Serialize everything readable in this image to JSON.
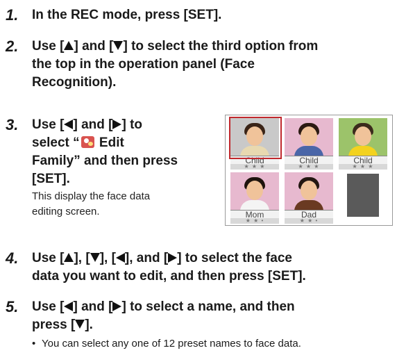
{
  "steps": [
    {
      "num": "1.",
      "text": "In the REC mode, press [SET]."
    },
    {
      "num": "2.",
      "lines": [
        "Use [▲] and [▼] to select the third option from",
        "the top in the operation panel (Face",
        "Recognition)."
      ]
    },
    {
      "num": "3.",
      "l1a": "Use [",
      "l1b": "] and [",
      "l1c": "] to",
      "l2a": "select “",
      "l2b": " Edit",
      "l3": "Family” and then press",
      "l4": "[SET].",
      "note1": "This display the face data",
      "note2": "editing screen."
    },
    {
      "num": "4.",
      "l1": [
        "Use [",
        "], [",
        "], [",
        "], and [",
        "] to select the face"
      ],
      "l2": "data you want to edit, and then press [SET]."
    },
    {
      "num": "5.",
      "l1a": "Use [",
      "l1b": "] and [",
      "l1c": "] to select a name, and then",
      "l2a": "press [",
      "l2b": "]."
    }
  ],
  "bullet": {
    "symbol": "•",
    "text": "You can select any one of 12 preset names to face data."
  },
  "screen": {
    "faces": [
      {
        "name": "Child",
        "stars": "★ ★ ★",
        "hair": "#3a2417",
        "shirt": "#e8d9b0",
        "bg": "#c9c9c9",
        "selected": true
      },
      {
        "name": "Child",
        "stars": "★ ★ ★",
        "hair": "#2b1a12",
        "shirt": "#4a66a8",
        "bg": "#e7b9cf",
        "selected": false
      },
      {
        "name": "Child",
        "stars": "★ ★ ★",
        "hair": "#3b2a1c",
        "shirt": "#f3d21f",
        "bg": "#9cc36a",
        "selected": false
      },
      {
        "name": "Mom",
        "stars": "★ ★ •",
        "hair": "#1e130d",
        "shirt": "#f4f4f4",
        "bg": "#e7b9cf",
        "selected": false
      },
      {
        "name": "Dad",
        "stars": "★ ★ •",
        "hair": "#231711",
        "shirt": "#6a3a22",
        "bg": "#e7b9cf",
        "selected": false
      },
      {
        "name": "",
        "stars": "",
        "empty": true
      }
    ]
  }
}
